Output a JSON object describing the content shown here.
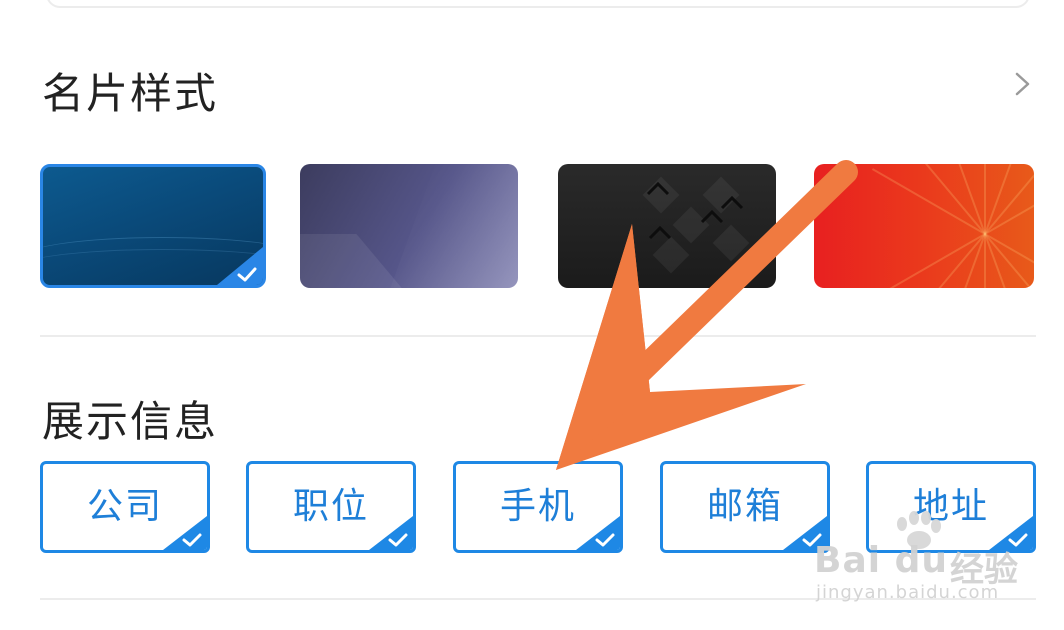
{
  "sections": {
    "style_title": "名片样式",
    "info_title": "展示信息"
  },
  "card_styles": [
    {
      "name": "blue",
      "selected": true,
      "color": "#0a4a7a"
    },
    {
      "name": "purple",
      "selected": false,
      "color": "#56568a"
    },
    {
      "name": "black",
      "selected": false,
      "color": "#1b1b1b"
    },
    {
      "name": "red",
      "selected": false,
      "color": "#e82020"
    }
  ],
  "info_tags": [
    {
      "label": "公司",
      "checked": true
    },
    {
      "label": "职位",
      "checked": true
    },
    {
      "label": "手机",
      "checked": true
    },
    {
      "label": "邮箱",
      "checked": true
    },
    {
      "label": "地址",
      "checked": true
    }
  ],
  "colors": {
    "accent": "#1e88e5",
    "arrow": "#f07a40",
    "divider": "#ececec"
  },
  "icons": {
    "chevron": "chevron-right-icon",
    "check": "check-icon"
  },
  "watermark": {
    "logo": "Bai du",
    "jingyan": "经验",
    "url": "jingyan.baidu.com"
  }
}
